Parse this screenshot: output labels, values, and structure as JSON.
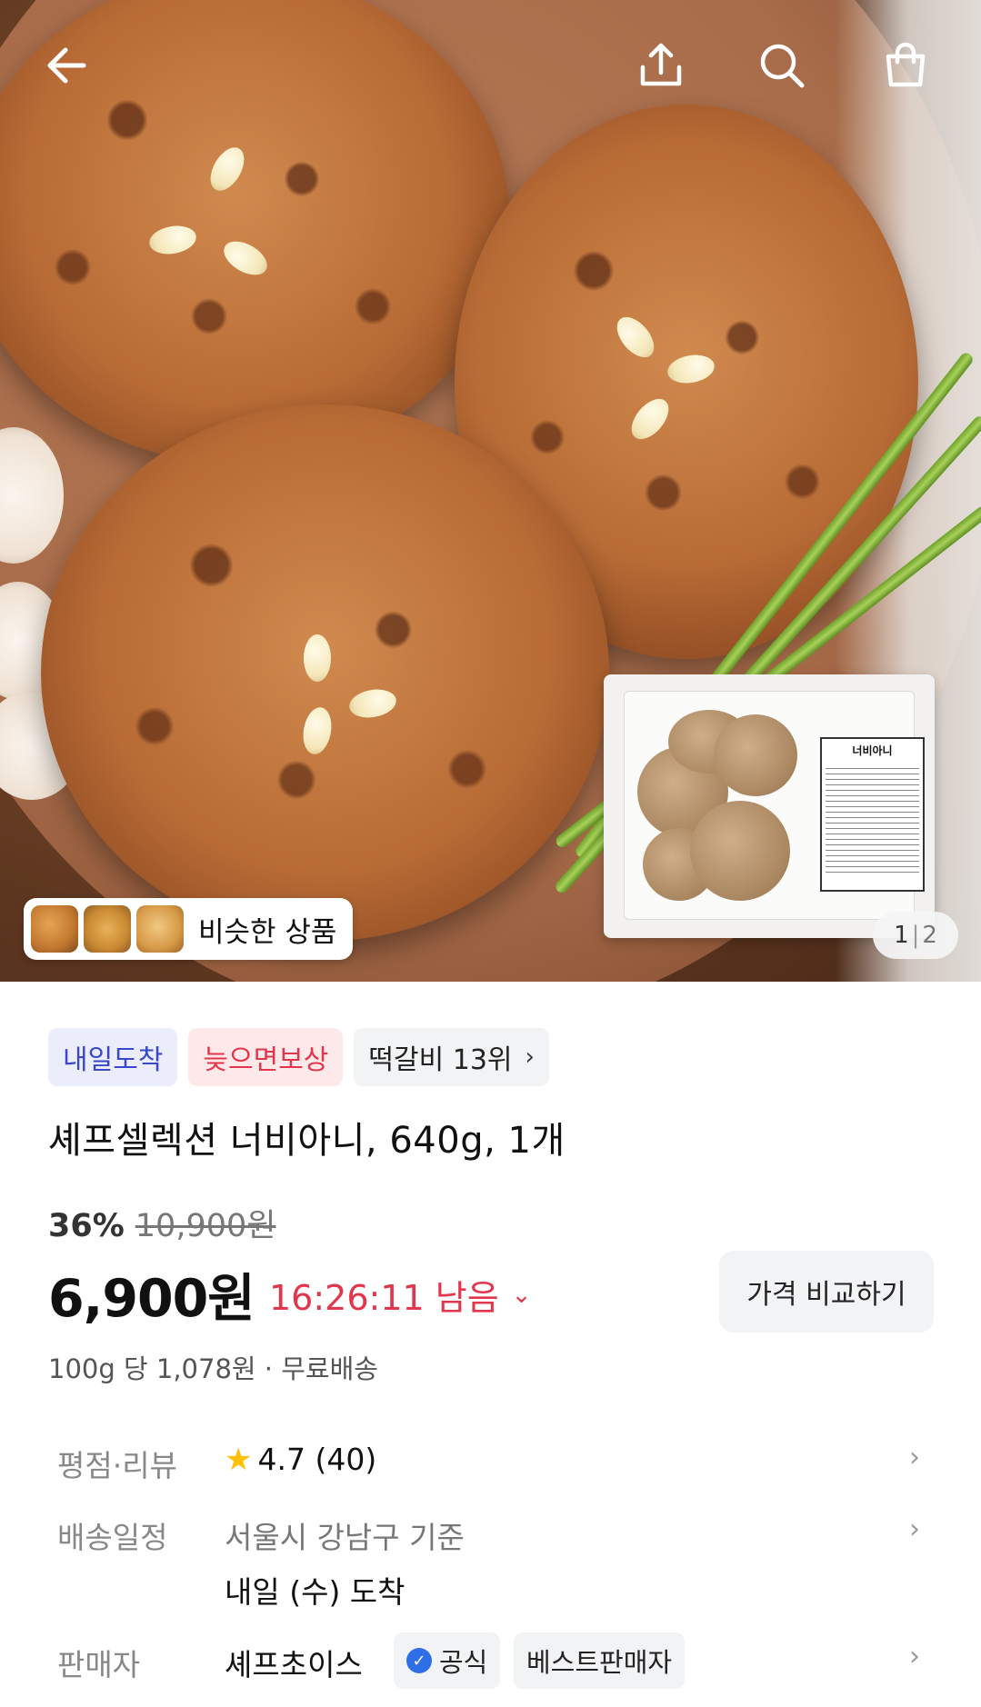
{
  "hero": {
    "similar_label": "비슷한 상품",
    "counter_current": "1",
    "counter_sep": "|",
    "counter_total": "2",
    "package_label": "너비아니"
  },
  "top_bar": {
    "icons": [
      "back-arrow-icon",
      "share-icon",
      "search-icon",
      "shopping-bag-icon"
    ]
  },
  "badges": {
    "delivery": "내일도착",
    "late_comp": "늦으면보상",
    "ranking": "떡갈비 13위",
    "ranking_chevron": "›"
  },
  "product": {
    "title": "셰프셀렉션 너비아니, 640g, 1개",
    "discount_pct": "36%",
    "original_price": "10,900원",
    "price": "6,900원",
    "timer": "16:26:11 남음",
    "timer_chevron": "⌄",
    "compare_button": "가격 비교하기",
    "unit_price": "100g 당 1,078원 · 무료배송"
  },
  "info": {
    "rating_label": "평점·리뷰",
    "rating_value": "4.7 (40)",
    "shipping_label": "배송일정",
    "shipping_location": "서울시 강남구 기준",
    "shipping_date": "내일 (수) 도착",
    "seller_label": "판매자",
    "seller_name": "셰프초이스",
    "official_badge": "공식",
    "best_seller_badge": "베스트판매자",
    "chevron": "›"
  },
  "colors": {
    "accent_red": "#e1364b",
    "accent_blue": "#3b47c9",
    "star": "#ffc107"
  }
}
